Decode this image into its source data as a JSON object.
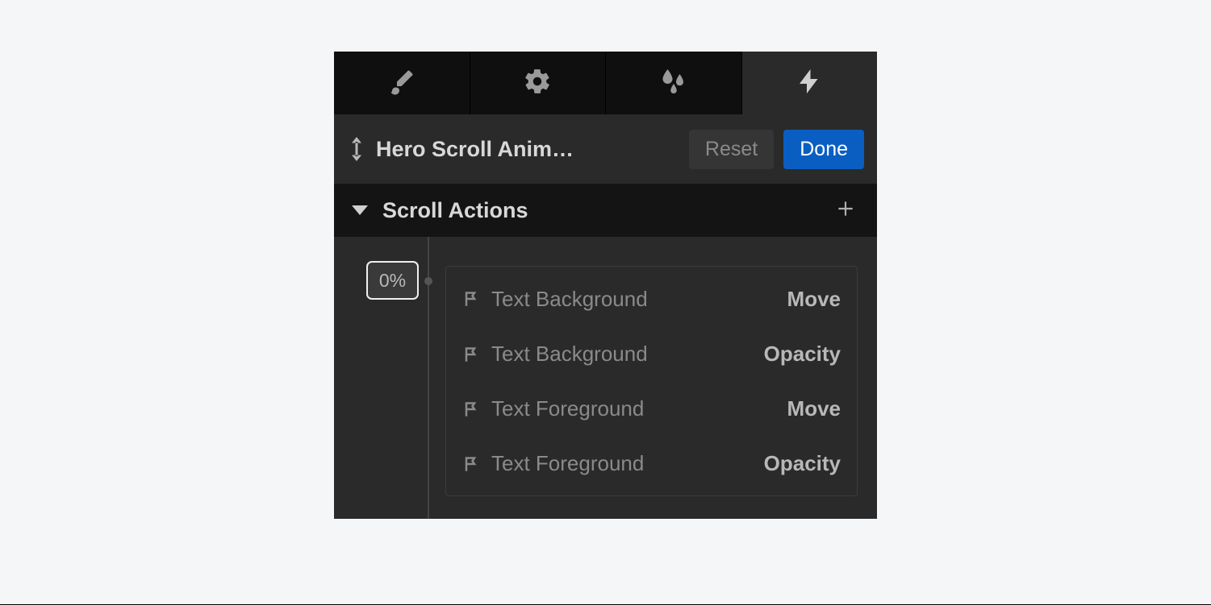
{
  "tabs": {
    "items": [
      {
        "name": "brush",
        "active": false
      },
      {
        "name": "gear",
        "active": false
      },
      {
        "name": "drops",
        "active": false
      },
      {
        "name": "bolt",
        "active": true
      }
    ]
  },
  "header": {
    "title": "Hero Scroll Anim…",
    "reset_label": "Reset",
    "done_label": "Done"
  },
  "section": {
    "title": "Scroll Actions"
  },
  "timeline": {
    "percent": "0%"
  },
  "actions": [
    {
      "label": "Text Background",
      "type": "Move"
    },
    {
      "label": "Text Background",
      "type": "Opacity"
    },
    {
      "label": "Text Foreground",
      "type": "Move"
    },
    {
      "label": "Text Foreground",
      "type": "Opacity"
    }
  ]
}
